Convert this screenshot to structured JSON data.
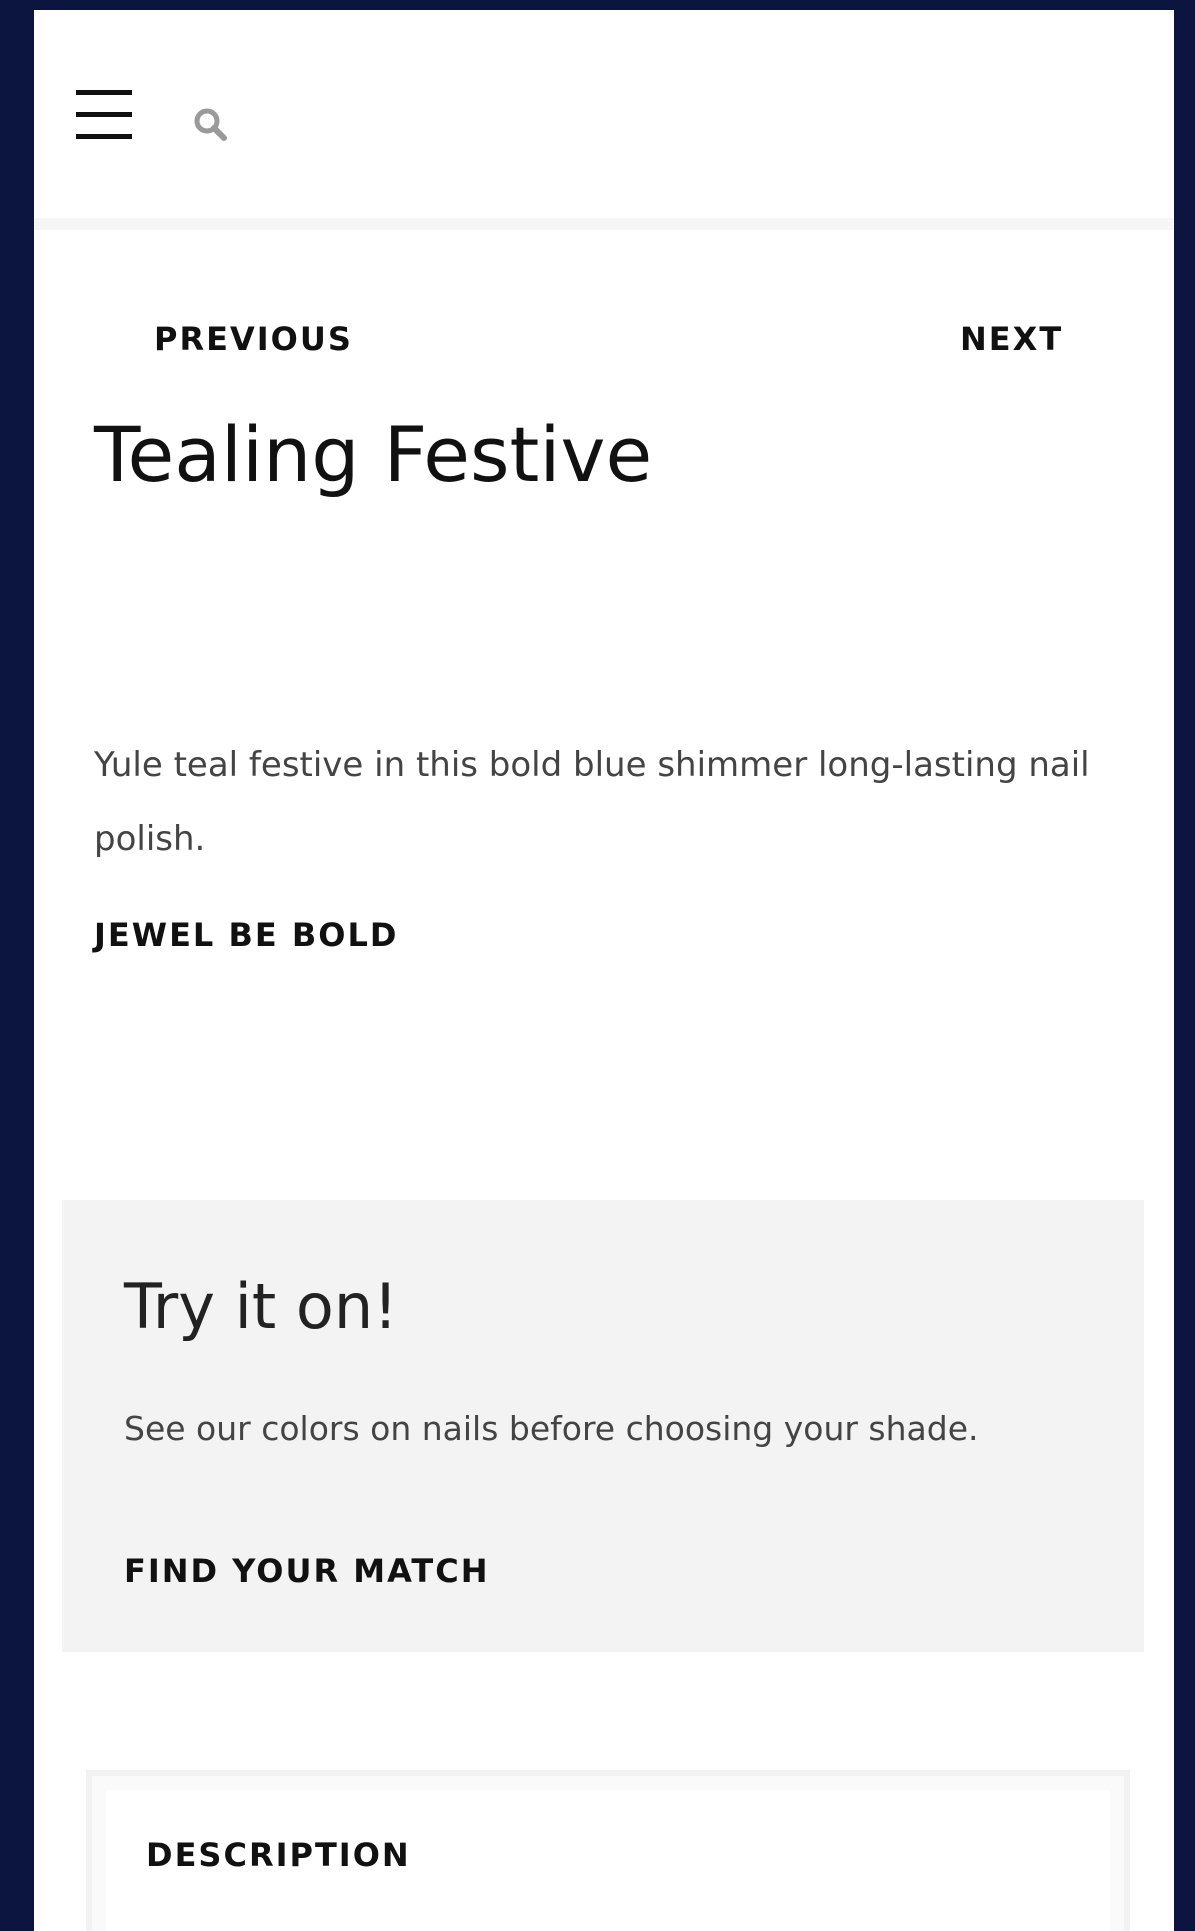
{
  "header": {
    "menu_icon": "hamburger-menu-icon",
    "search_icon": "search-icon"
  },
  "pager": {
    "previous_label": "PREVIOUS",
    "next_label": "NEXT"
  },
  "product": {
    "title": "Tealing Festive",
    "description": "Yule teal festive in this bold blue shimmer long-lasting nail polish.",
    "collection_link": "JEWEL BE BOLD"
  },
  "try_on": {
    "heading": "Try it on!",
    "text": "See our colors on nails before choosing your shade.",
    "cta_label": "FIND YOUR MATCH"
  },
  "accordion": {
    "description_label": "DESCRIPTION"
  },
  "colors": {
    "page_border": "#0b1540",
    "panel_bg": "#f3f3f3",
    "text": "#111111"
  }
}
